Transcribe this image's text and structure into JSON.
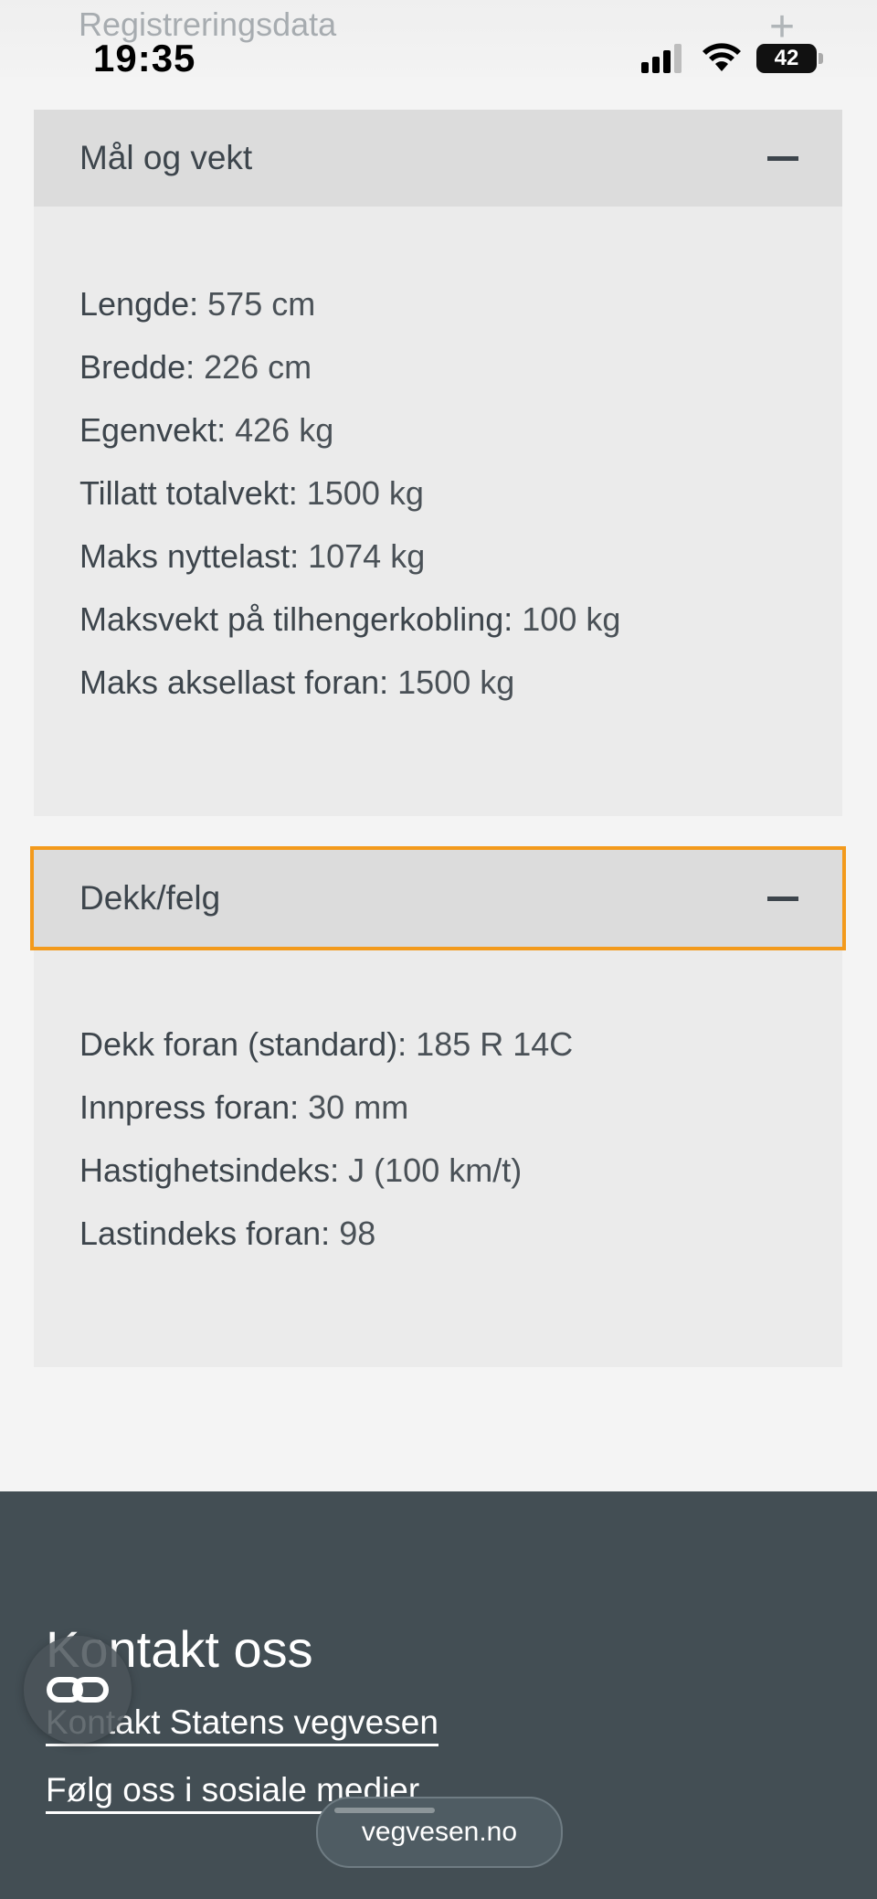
{
  "status_bar": {
    "time": "19:35",
    "battery": "42",
    "behind_section_title": "Registreringsdata",
    "behind_section_icon": "+"
  },
  "sections": [
    {
      "title": "Mål og vekt",
      "toggle_icon": "minus-icon",
      "fields": [
        {
          "label": "Lengde:",
          "value": "575 cm"
        },
        {
          "label": "Bredde:",
          "value": "226 cm"
        },
        {
          "label": "Egenvekt:",
          "value": "426 kg"
        },
        {
          "label": "Tillatt totalvekt:",
          "value": "1500 kg"
        },
        {
          "label": "Maks nyttelast:",
          "value": "1074 kg"
        },
        {
          "label": "Maksvekt på tilhengerkobling:",
          "value": "100 kg"
        },
        {
          "label": "Maks aksellast foran:",
          "value": "1500 kg"
        }
      ]
    },
    {
      "title": "Dekk/felg",
      "toggle_icon": "minus-icon",
      "fields": [
        {
          "label": "Dekk foran (standard):",
          "value": "185 R 14C"
        },
        {
          "label": "Innpress foran:",
          "value": "30 mm"
        },
        {
          "label": "Hastighetsindeks:",
          "value": "J (100 km/t)"
        },
        {
          "label": "Lastindeks foran:",
          "value": "98"
        }
      ]
    }
  ],
  "footer": {
    "title": "Kontakt oss",
    "links": [
      "Kontakt Statens vegvesen",
      "Følg oss i sosiale medier"
    ]
  },
  "browser": {
    "url": "vegvesen.no"
  },
  "colors": {
    "page_bg": "#f4f4f4",
    "panel_bg": "#ebebeb",
    "panel_header_bg": "#dcdcdc",
    "text": "#3d454c",
    "focus_outline": "#f39a1c",
    "footer_bg": "#434e54"
  }
}
